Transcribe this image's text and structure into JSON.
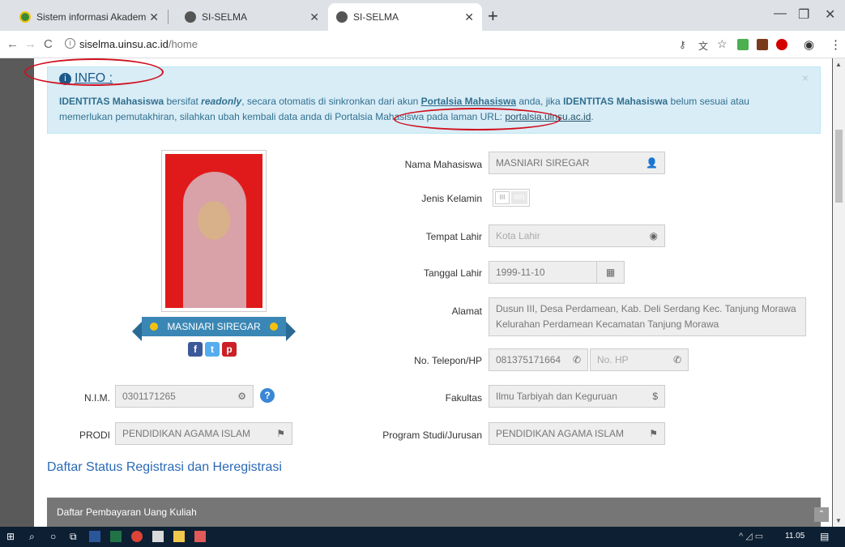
{
  "browser": {
    "tabs": [
      {
        "title": "Sistem informasi Akademik - Uni"
      },
      {
        "title": "SI-SELMA"
      },
      {
        "title": "SI-SELMA"
      }
    ],
    "new_tab": "+",
    "url_host": "siselma.uinsu.ac.id",
    "url_path": "/home"
  },
  "alert": {
    "title": "INFO :",
    "text_1": "IDENTITAS Mahasiswa",
    "text_2": " bersifat ",
    "text_3": "readonly",
    "text_4": ", secara otomatis di sinkronkan dari akun ",
    "text_5": "Portalsia Mahasiswa",
    "text_6": " anda, jika ",
    "text_7": "IDENTITAS Mahasiswa",
    "text_8": " belum sesuai atau memerlukan pemutakhiran, silahkan ubah kembali data anda di Portalsia Mahasiswa pada laman URL: ",
    "link": "portalsia.uinsu.ac.id",
    "text_9": ".",
    "close": "×"
  },
  "profile": {
    "name": "MASNIARI SIREGAR"
  },
  "form": {
    "nama_label": "Nama Mahasiswa",
    "nama_value": "MASNIARI SIREGAR",
    "jk_label": "Jenis Kelamin",
    "jk_off": "III",
    "jk_on": "WN",
    "tempat_label": "Tempat Lahir",
    "tempat_placeholder": "Kota Lahir",
    "tanggal_label": "Tanggal Lahir",
    "tanggal_value": "1999-11-10",
    "alamat_label": "Alamat",
    "alamat_value": "Dusun III, Desa Perdamean, Kab. Deli Serdang Kec. Tanjung Morawa Kelurahan Perdamean Kecamatan Tanjung Morawa",
    "telepon_label": "No. Telepon/HP",
    "telepon_value": "081375171664",
    "hp_placeholder": "No. HP",
    "fakultas_label": "Fakultas",
    "fakultas_value": "Ilmu Tarbiyah dan Keguruan",
    "prodi_label2": "Program Studi/Jurusan",
    "prodi_value2": "PENDIDIKAN AGAMA ISLAM",
    "nim_label": "N.I.M.",
    "nim_value": "0301171265",
    "prodi_label": "PRODI",
    "prodi_value": "PENDIDIKAN AGAMA ISLAM"
  },
  "section": {
    "title": "Daftar Status Registrasi dan Heregistrasi",
    "pay_bar": "Daftar Pembayaran Uang Kuliah"
  },
  "taskbar": {
    "time": "11.05"
  },
  "colors": {
    "accent": "#2a6ab5",
    "alert_bg": "#d9edf7",
    "annotation": "#d0101e"
  }
}
